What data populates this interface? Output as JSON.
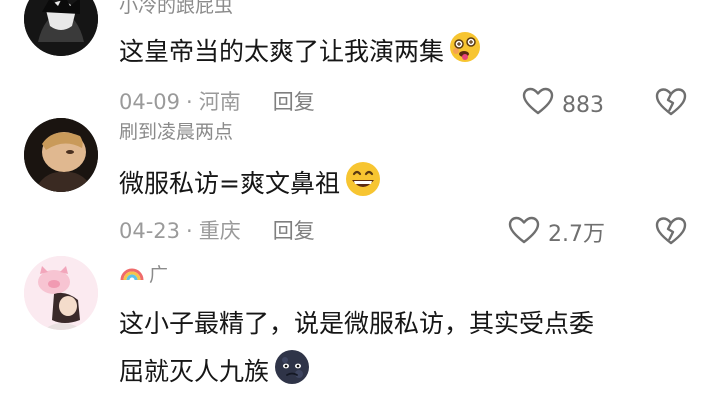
{
  "comments": [
    {
      "username": "小冷的跟屁虫",
      "text": "这皇帝当的太爽了让我演两集",
      "emoji_icon": "drunk-face-emoji",
      "date": "04-09",
      "location": "河南",
      "reply_label": "回复",
      "likes": "883"
    },
    {
      "username": "刷到凌晨两点",
      "text": "微服私访=爽文鼻祖",
      "emoji_icon": "grinning-face-emoji",
      "date": "04-23",
      "location": "重庆",
      "reply_label": "回复",
      "likes": "2.7万"
    },
    {
      "username": "广",
      "username_icon": "rainbow-emoji",
      "text_line1": "这小子最精了，说是微服私访，其实受点委",
      "text_line2": "屈就灭人九族",
      "emoji_icon": "dark-moon-face-emoji"
    }
  ],
  "colors": {
    "text": "#161616",
    "secondary": "#9a9a9a",
    "background": "#ffffff"
  }
}
